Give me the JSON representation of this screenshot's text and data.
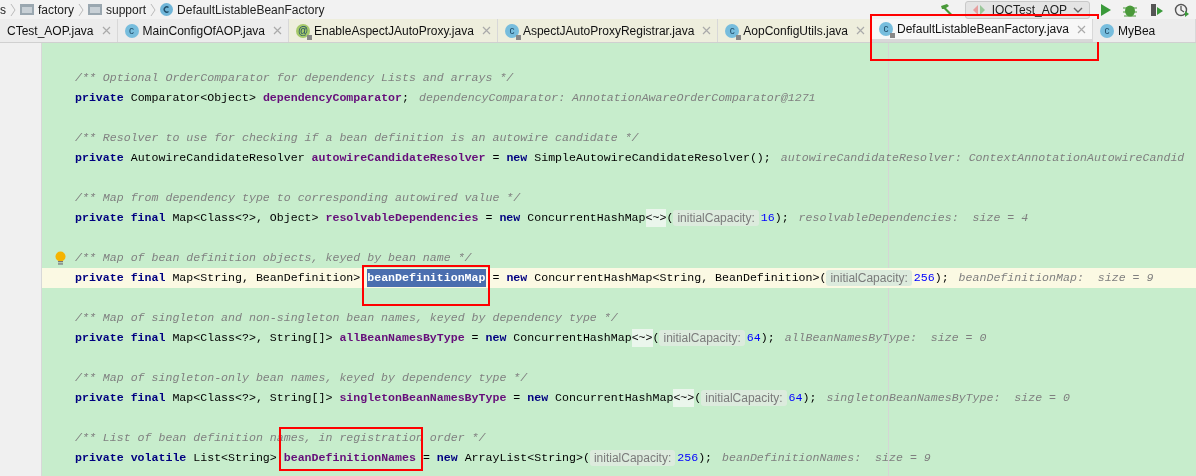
{
  "breadcrumbs": [
    {
      "kind": "text",
      "label": "s"
    },
    {
      "kind": "folder",
      "label": "factory"
    },
    {
      "kind": "folder",
      "label": "support"
    },
    {
      "kind": "class",
      "label": "DefaultListableBeanFactory"
    }
  ],
  "run_config": {
    "label": "IOCTest_AOP"
  },
  "tabs": [
    {
      "label": "CTest_AOP.java",
      "library": false,
      "selected": false,
      "framed": false
    },
    {
      "label": "MainConfigOfAOP.java",
      "icon": "c",
      "library": false,
      "selected": false,
      "framed": false
    },
    {
      "label": "EnableAspectJAutoProxy.java",
      "icon": "@",
      "library": true,
      "selected": false,
      "framed": false
    },
    {
      "label": "AspectJAutoProxyRegistrar.java",
      "icon": "c",
      "library": true,
      "selected": false,
      "framed": false
    },
    {
      "label": "AopConfigUtils.java",
      "icon": "c",
      "library": true,
      "selected": false,
      "framed": false
    },
    {
      "label": "DefaultListableBeanFactory.java",
      "icon": "c",
      "library": true,
      "selected": true,
      "framed": true
    },
    {
      "label": "MyBea",
      "icon": "c",
      "library": false,
      "selected": false,
      "framed": false
    }
  ],
  "editor": {
    "blocks": [
      {
        "bulb": false,
        "current": false,
        "framed": false,
        "comment": "/** Optional OrderComparator for dependency Lists and arrays */",
        "code": [
          {
            "kind": "keyword",
            "text": "private "
          },
          {
            "kind": "plain",
            "text": "Comparator<Object> "
          },
          {
            "kind": "field",
            "text": "dependencyComparator"
          },
          {
            "kind": "plain",
            "text": ";"
          },
          {
            "kind": "value",
            "text": "dependencyComparator: AnnotationAwareOrderComparator@1271"
          }
        ]
      },
      {
        "bulb": false,
        "current": false,
        "framed": false,
        "comment": "/** Resolver to use for checking if a bean definition is an autowire candidate */",
        "code": [
          {
            "kind": "keyword",
            "text": "private "
          },
          {
            "kind": "plain",
            "text": "AutowireCandidateResolver "
          },
          {
            "kind": "field",
            "text": "autowireCandidateResolver"
          },
          {
            "kind": "plain",
            "text": " = "
          },
          {
            "kind": "keyword",
            "text": "new "
          },
          {
            "kind": "plain",
            "text": "SimpleAutowireCandidateResolver();"
          },
          {
            "kind": "value",
            "text": "autowireCandidateResolver: ContextAnnotationAutowireCandid"
          }
        ]
      },
      {
        "bulb": false,
        "current": false,
        "framed": false,
        "comment": "/** Map from dependency type to corresponding autowired value */",
        "code": [
          {
            "kind": "keyword",
            "text": "private final "
          },
          {
            "kind": "plain",
            "text": "Map<Class<?>, Object> "
          },
          {
            "kind": "field",
            "text": "resolvableDependencies"
          },
          {
            "kind": "plain",
            "text": " = "
          },
          {
            "kind": "keyword",
            "text": "new "
          },
          {
            "kind": "plain",
            "text": "ConcurrentHashMap"
          },
          {
            "kind": "fold",
            "text": "<~>"
          },
          {
            "kind": "plain",
            "text": "("
          },
          {
            "kind": "hint",
            "text": "initialCapacity:"
          },
          {
            "kind": "number",
            "text": "16"
          },
          {
            "kind": "plain",
            "text": ");"
          },
          {
            "kind": "value",
            "text": "resolvableDependencies:  size = 4"
          }
        ]
      },
      {
        "bulb": true,
        "current": true,
        "framed": false,
        "comment": "/** Map of bean definition objects, keyed by bean name */",
        "code": [
          {
            "kind": "keyword",
            "text": "private final "
          },
          {
            "kind": "plain",
            "text": "Map<String, BeanDefinition> "
          },
          {
            "kind": "selection",
            "text": "beanDefinitionMap",
            "framed": true
          },
          {
            "kind": "plain",
            "text": " = "
          },
          {
            "kind": "keyword",
            "text": "new "
          },
          {
            "kind": "plain",
            "text": "ConcurrentHashMap<String, BeanDefinition>("
          },
          {
            "kind": "hint",
            "text": "initialCapacity:"
          },
          {
            "kind": "number",
            "text": "256"
          },
          {
            "kind": "plain",
            "text": ");"
          },
          {
            "kind": "value",
            "text": "beanDefinitionMap:  size = 9"
          }
        ]
      },
      {
        "bulb": false,
        "current": false,
        "framed": false,
        "comment": "/** Map of singleton and non-singleton bean names, keyed by dependency type */",
        "code": [
          {
            "kind": "keyword",
            "text": "private final "
          },
          {
            "kind": "plain",
            "text": "Map<Class<?>, String[]> "
          },
          {
            "kind": "field",
            "text": "allBeanNamesByType"
          },
          {
            "kind": "plain",
            "text": " = "
          },
          {
            "kind": "keyword",
            "text": "new "
          },
          {
            "kind": "plain",
            "text": "ConcurrentHashMap"
          },
          {
            "kind": "fold",
            "text": "<~>"
          },
          {
            "kind": "plain",
            "text": "("
          },
          {
            "kind": "hint",
            "text": "initialCapacity:"
          },
          {
            "kind": "number",
            "text": "64"
          },
          {
            "kind": "plain",
            "text": ");"
          },
          {
            "kind": "value",
            "text": "allBeanNamesByType:  size = 0"
          }
        ]
      },
      {
        "bulb": false,
        "current": false,
        "framed": false,
        "comment": "/** Map of singleton-only bean names, keyed by dependency type */",
        "code": [
          {
            "kind": "keyword",
            "text": "private final "
          },
          {
            "kind": "plain",
            "text": "Map<Class<?>, String[]> "
          },
          {
            "kind": "field",
            "text": "singletonBeanNamesByType"
          },
          {
            "kind": "plain",
            "text": " = "
          },
          {
            "kind": "keyword",
            "text": "new "
          },
          {
            "kind": "plain",
            "text": "ConcurrentHashMap"
          },
          {
            "kind": "fold",
            "text": "<~>"
          },
          {
            "kind": "plain",
            "text": "("
          },
          {
            "kind": "hint",
            "text": "initialCapacity:"
          },
          {
            "kind": "number",
            "text": "64"
          },
          {
            "kind": "plain",
            "text": ");"
          },
          {
            "kind": "value",
            "text": "singletonBeanNamesByType:  size = 0"
          }
        ]
      },
      {
        "bulb": false,
        "current": false,
        "framed": true,
        "comment": "/** List of bean definition names, in registration order */",
        "code": [
          {
            "kind": "keyword",
            "text": "private volatile "
          },
          {
            "kind": "plain",
            "text": "List<String> "
          },
          {
            "kind": "field",
            "text": "beanDefinitionNames"
          },
          {
            "kind": "plain",
            "text": " = "
          },
          {
            "kind": "keyword",
            "text": "new "
          },
          {
            "kind": "plain",
            "text": "ArrayList<String>("
          },
          {
            "kind": "hint",
            "text": "initialCapacity:"
          },
          {
            "kind": "number",
            "text": "256"
          },
          {
            "kind": "plain",
            "text": ");"
          },
          {
            "kind": "value",
            "text": "beanDefinitionNames:  size = 9"
          }
        ]
      }
    ]
  }
}
